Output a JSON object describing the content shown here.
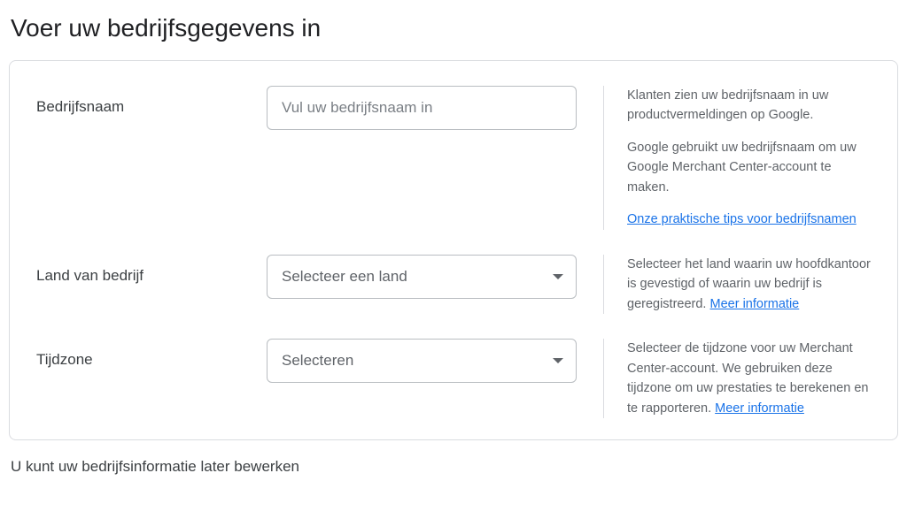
{
  "title": "Voer uw bedrijfsgegevens in",
  "fields": {
    "business_name": {
      "label": "Bedrijfsnaam",
      "placeholder": "Vul uw bedrijfsnaam in",
      "help1": "Klanten zien uw bedrijfsnaam in uw productvermeldingen op Google.",
      "help2": "Google gebruikt uw bedrijfsnaam om uw Google Merchant Center-account te maken.",
      "tips_link": "Onze praktische tips voor bedrijfsnamen"
    },
    "country": {
      "label": "Land van bedrijf",
      "placeholder": "Selecteer een land",
      "help": "Selecteer het land waarin uw hoofdkantoor is gevestigd of waarin uw bedrijf is geregistreerd. ",
      "more_link": "Meer informatie"
    },
    "timezone": {
      "label": "Tijdzone",
      "placeholder": "Selecteren",
      "help": "Selecteer de tijdzone voor uw Merchant Center-account. We gebruiken deze tijdzone om uw prestaties te berekenen en te rapporteren. ",
      "more_link": "Meer informatie"
    }
  },
  "footer": "U kunt uw bedrijfsinformatie later bewerken"
}
